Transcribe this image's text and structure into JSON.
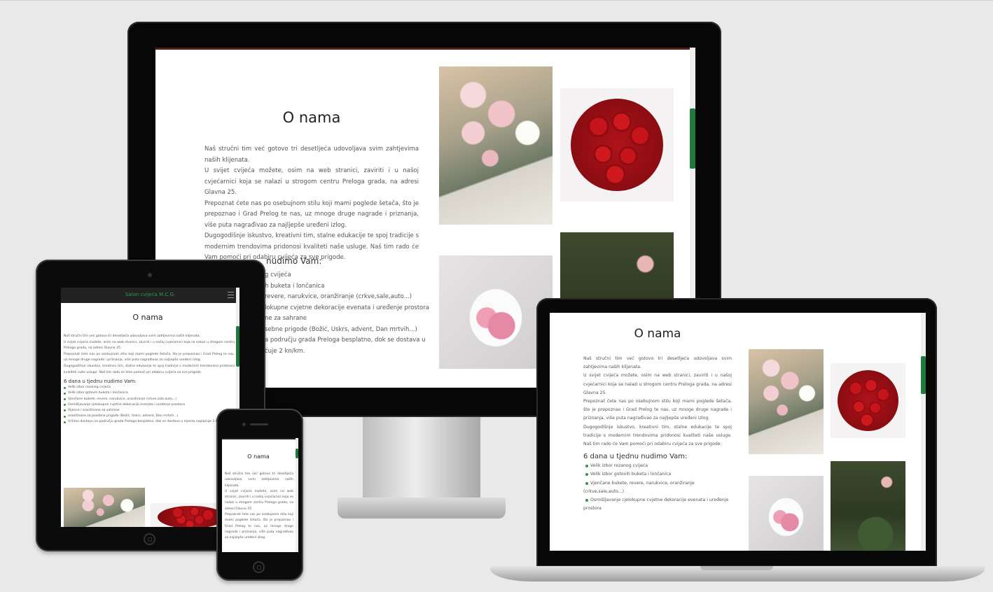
{
  "site": {
    "brand": "Salon cvijeća M.C.G.",
    "heading": "O nama",
    "paragraphs": [
      "Naš stručni tim već gotovo tri desetljeća udovoljava svim zahtjevima naših klijenata.",
      "U svijet cvijeća možete, osim na web stranici, zaviriti i u našoj cvjećarnici koja se nalazi u strogom centru Preloga grada, na adresi Glavna 25.",
      "Prepoznat ćete nas po osebujnom stilu koji mami poglede šetača, što je prepoznao i Grad Prelog te nas, uz mnoge druge nagrade i priznanja, više puta nagrađivao za najljepše uređeni izlog.",
      "Dugogodišnje iskustvo, kreativni tim, stalne edukacije te spoj tradicije s modernim trendovima pridonosi kvaliteti naše usluge. Naš tim rado će Vam pomoći pri odabiru cvijeća za sve prigode."
    ],
    "subheading": "6 dana u tjednu nudimo Vam:",
    "services": [
      "Velik izbor rezanog cvijeća",
      "Velik izbor gotovih buketa i lončanica",
      "Vjenčane bukete, revere, narukvice, oranžiranje (crkve,sale,auto...)",
      "Osmišljavanje cjelokupne cvjetne dekoracije evenata i uređenje prostora",
      "Vijence i aranžmane za sahrane",
      "aranžmane za posebne prigode (Božić, Uskrs, advent, Dan mrtvih...)",
      "Vršimo dostavu na području grada Preloga besplatno, dok se dostava u mjesta naplaćuje 2 kn/km."
    ]
  },
  "desktop_partial": {
    "sub_tail": "nudimo Vam:",
    "service_tails": [
      "g cvijeća",
      "h buketa i lončanica",
      "revere, narukvice, oranžiranje (crkve,sale,auto...)",
      "lokupne cvjetne dekoracije evenata i uređenje prostora",
      "ne za sahrane",
      "sebne prigode (Božić, Uskrs, advent, Dan mrtvih...)",
      "a području grada Preloga besplatno, dok se dostava u",
      "ćuje 2 kn/km."
    ]
  },
  "laptop_services": [
    "Velik izbor rezanog cvijeća",
    "Velik izbor gotovih buketa i lončanica",
    "Vjenčane bukete, revere, narukvice, oranžiranje (crkve,sale,auto...)",
    "Osmišljavanje cjelokupne cvjetne dekoracije evenata i uređenje prostora"
  ],
  "colors": {
    "accent": "#1f7a3d",
    "bullet": "#3a8f4e",
    "nav_bg": "#222222",
    "brand_text": "#2e9b4f"
  },
  "icons": {
    "menu": "hamburger-menu-icon",
    "home_button": "home-button-icon"
  }
}
